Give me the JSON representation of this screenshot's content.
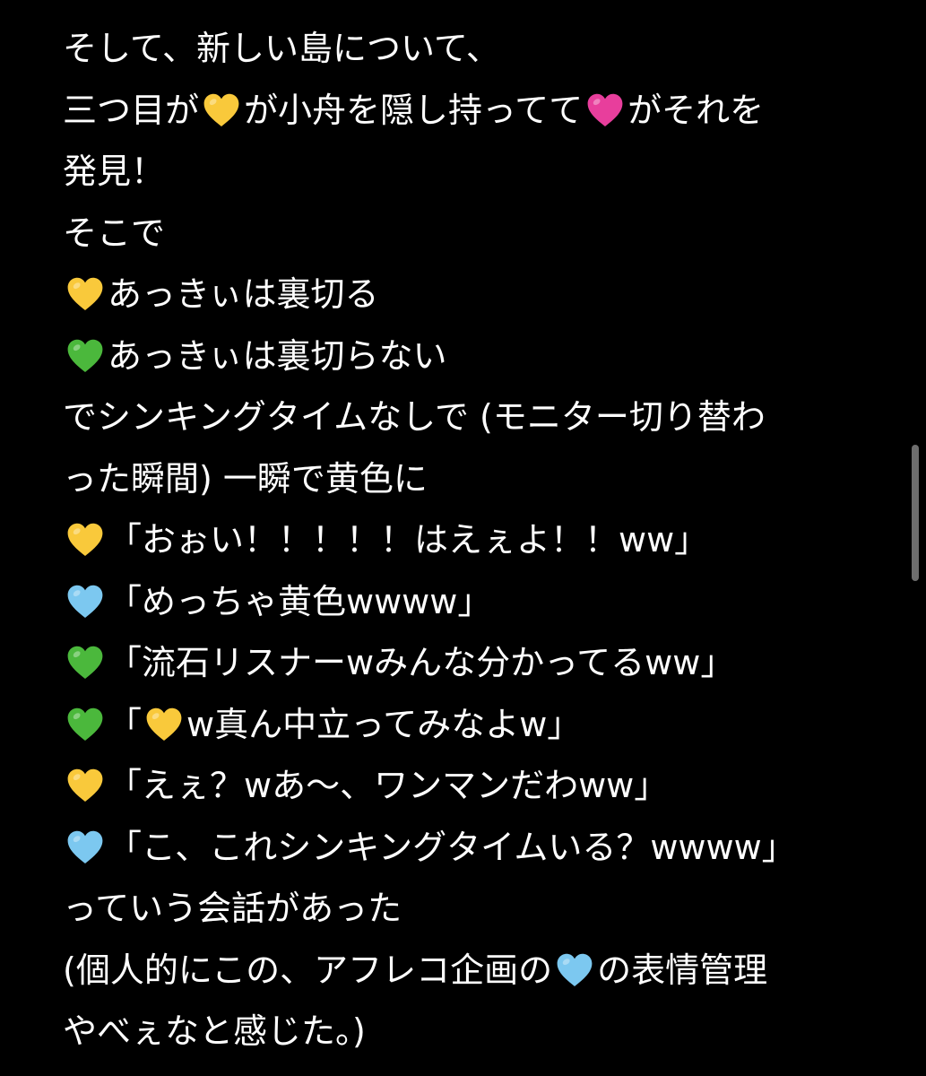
{
  "colors": {
    "background": "#000000",
    "text": "#ffffff",
    "heart_yellow": "#f9c93b",
    "heart_pink": "#e83e9c",
    "heart_green": "#4bb83c",
    "heart_blue": "#7cc8f0",
    "scrollbar": "#6e6e6e"
  },
  "note": {
    "lines": [
      {
        "t1": "そして、新しい島について、"
      },
      {
        "t1": "三つ目が",
        "h1": "yellow-heart",
        "t2": "が小舟を隠し持ってて",
        "h2": "pink-heart",
        "t3": "がそれを"
      },
      {
        "t1": "発見！"
      },
      {
        "t1": "そこで"
      },
      {
        "h1": "yellow-heart",
        "t1": "あっきぃは裏切る"
      },
      {
        "h1": "green-heart",
        "t1": "あっきぃは裏切らない"
      },
      {
        "t1": "でシンキングタイムなしで (モニター切り替わ"
      },
      {
        "t1": "った瞬間) 一瞬で黄色に"
      },
      {
        "h1": "yellow-heart",
        "t1": "「おぉい！！！！！はえぇよ！！ww」"
      },
      {
        "h1": "blue-heart",
        "t1": "「めっちゃ黄色wwww」"
      },
      {
        "h1": "green-heart",
        "t1": "「流石リスナーwみんな分かってるww」"
      },
      {
        "h1": "green-heart",
        "t1": "「",
        "h2": "yellow-heart",
        "t2": "w真ん中立ってみなよw」"
      },
      {
        "h1": "yellow-heart",
        "t1": "「えぇ？wあ～、ワンマンだわww」"
      },
      {
        "h1": "blue-heart",
        "t1": "「こ、これシンキングタイムいる？wwww」"
      },
      {
        "t1": "っていう会話があった"
      },
      {
        "t1": "(個人的にこの、アフレコ企画の",
        "h1": "blue-heart",
        "t2": "の表情管理"
      },
      {
        "t1": "やべぇなと感じた。)"
      }
    ]
  }
}
